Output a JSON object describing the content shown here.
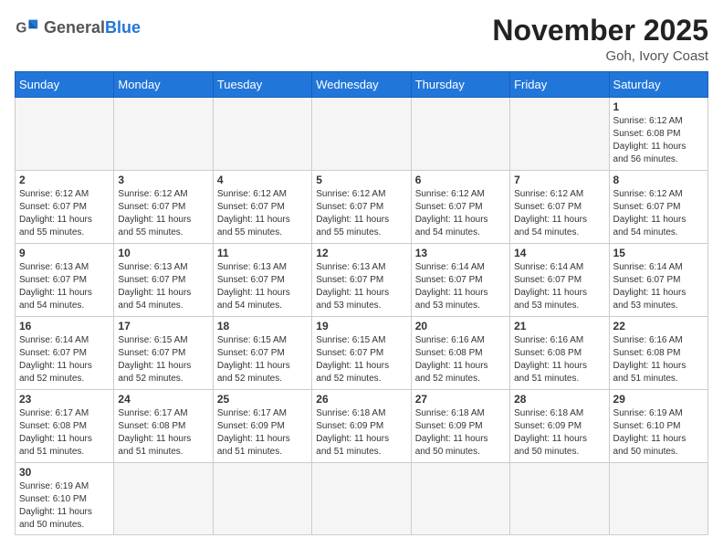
{
  "header": {
    "logo_general": "General",
    "logo_blue": "Blue",
    "month_title": "November 2025",
    "location": "Goh, Ivory Coast"
  },
  "weekdays": [
    "Sunday",
    "Monday",
    "Tuesday",
    "Wednesday",
    "Thursday",
    "Friday",
    "Saturday"
  ],
  "weeks": [
    [
      {
        "day": "",
        "info": ""
      },
      {
        "day": "",
        "info": ""
      },
      {
        "day": "",
        "info": ""
      },
      {
        "day": "",
        "info": ""
      },
      {
        "day": "",
        "info": ""
      },
      {
        "day": "",
        "info": ""
      },
      {
        "day": "1",
        "info": "Sunrise: 6:12 AM\nSunset: 6:08 PM\nDaylight: 11 hours\nand 56 minutes."
      }
    ],
    [
      {
        "day": "2",
        "info": "Sunrise: 6:12 AM\nSunset: 6:07 PM\nDaylight: 11 hours\nand 55 minutes."
      },
      {
        "day": "3",
        "info": "Sunrise: 6:12 AM\nSunset: 6:07 PM\nDaylight: 11 hours\nand 55 minutes."
      },
      {
        "day": "4",
        "info": "Sunrise: 6:12 AM\nSunset: 6:07 PM\nDaylight: 11 hours\nand 55 minutes."
      },
      {
        "day": "5",
        "info": "Sunrise: 6:12 AM\nSunset: 6:07 PM\nDaylight: 11 hours\nand 55 minutes."
      },
      {
        "day": "6",
        "info": "Sunrise: 6:12 AM\nSunset: 6:07 PM\nDaylight: 11 hours\nand 54 minutes."
      },
      {
        "day": "7",
        "info": "Sunrise: 6:12 AM\nSunset: 6:07 PM\nDaylight: 11 hours\nand 54 minutes."
      },
      {
        "day": "8",
        "info": "Sunrise: 6:12 AM\nSunset: 6:07 PM\nDaylight: 11 hours\nand 54 minutes."
      }
    ],
    [
      {
        "day": "9",
        "info": "Sunrise: 6:13 AM\nSunset: 6:07 PM\nDaylight: 11 hours\nand 54 minutes."
      },
      {
        "day": "10",
        "info": "Sunrise: 6:13 AM\nSunset: 6:07 PM\nDaylight: 11 hours\nand 54 minutes."
      },
      {
        "day": "11",
        "info": "Sunrise: 6:13 AM\nSunset: 6:07 PM\nDaylight: 11 hours\nand 54 minutes."
      },
      {
        "day": "12",
        "info": "Sunrise: 6:13 AM\nSunset: 6:07 PM\nDaylight: 11 hours\nand 53 minutes."
      },
      {
        "day": "13",
        "info": "Sunrise: 6:14 AM\nSunset: 6:07 PM\nDaylight: 11 hours\nand 53 minutes."
      },
      {
        "day": "14",
        "info": "Sunrise: 6:14 AM\nSunset: 6:07 PM\nDaylight: 11 hours\nand 53 minutes."
      },
      {
        "day": "15",
        "info": "Sunrise: 6:14 AM\nSunset: 6:07 PM\nDaylight: 11 hours\nand 53 minutes."
      }
    ],
    [
      {
        "day": "16",
        "info": "Sunrise: 6:14 AM\nSunset: 6:07 PM\nDaylight: 11 hours\nand 52 minutes."
      },
      {
        "day": "17",
        "info": "Sunrise: 6:15 AM\nSunset: 6:07 PM\nDaylight: 11 hours\nand 52 minutes."
      },
      {
        "day": "18",
        "info": "Sunrise: 6:15 AM\nSunset: 6:07 PM\nDaylight: 11 hours\nand 52 minutes."
      },
      {
        "day": "19",
        "info": "Sunrise: 6:15 AM\nSunset: 6:07 PM\nDaylight: 11 hours\nand 52 minutes."
      },
      {
        "day": "20",
        "info": "Sunrise: 6:16 AM\nSunset: 6:08 PM\nDaylight: 11 hours\nand 52 minutes."
      },
      {
        "day": "21",
        "info": "Sunrise: 6:16 AM\nSunset: 6:08 PM\nDaylight: 11 hours\nand 51 minutes."
      },
      {
        "day": "22",
        "info": "Sunrise: 6:16 AM\nSunset: 6:08 PM\nDaylight: 11 hours\nand 51 minutes."
      }
    ],
    [
      {
        "day": "23",
        "info": "Sunrise: 6:17 AM\nSunset: 6:08 PM\nDaylight: 11 hours\nand 51 minutes."
      },
      {
        "day": "24",
        "info": "Sunrise: 6:17 AM\nSunset: 6:08 PM\nDaylight: 11 hours\nand 51 minutes."
      },
      {
        "day": "25",
        "info": "Sunrise: 6:17 AM\nSunset: 6:09 PM\nDaylight: 11 hours\nand 51 minutes."
      },
      {
        "day": "26",
        "info": "Sunrise: 6:18 AM\nSunset: 6:09 PM\nDaylight: 11 hours\nand 51 minutes."
      },
      {
        "day": "27",
        "info": "Sunrise: 6:18 AM\nSunset: 6:09 PM\nDaylight: 11 hours\nand 50 minutes."
      },
      {
        "day": "28",
        "info": "Sunrise: 6:18 AM\nSunset: 6:09 PM\nDaylight: 11 hours\nand 50 minutes."
      },
      {
        "day": "29",
        "info": "Sunrise: 6:19 AM\nSunset: 6:10 PM\nDaylight: 11 hours\nand 50 minutes."
      }
    ],
    [
      {
        "day": "30",
        "info": "Sunrise: 6:19 AM\nSunset: 6:10 PM\nDaylight: 11 hours\nand 50 minutes."
      },
      {
        "day": "",
        "info": ""
      },
      {
        "day": "",
        "info": ""
      },
      {
        "day": "",
        "info": ""
      },
      {
        "day": "",
        "info": ""
      },
      {
        "day": "",
        "info": ""
      },
      {
        "day": "",
        "info": ""
      }
    ]
  ]
}
